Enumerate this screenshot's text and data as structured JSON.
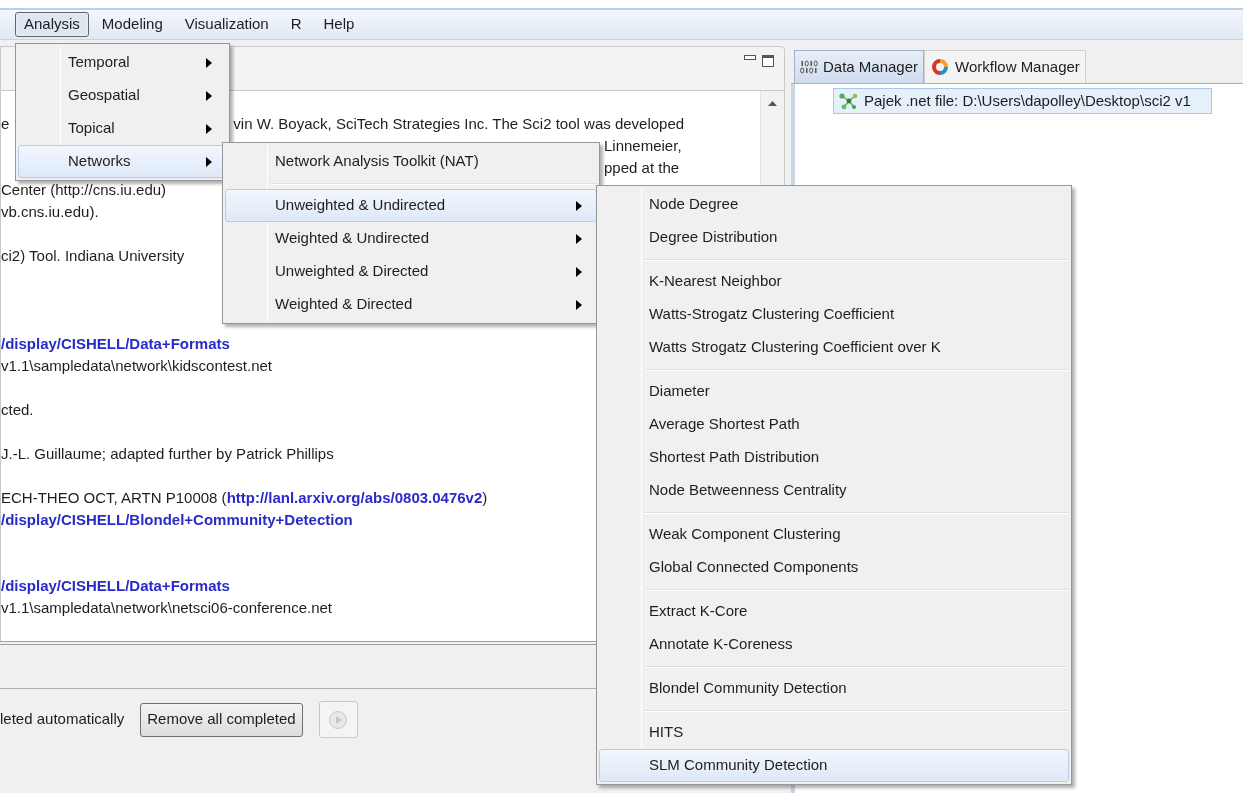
{
  "menu_bar": [
    {
      "label": "Analysis",
      "selected": true
    },
    {
      "label": "Modeling",
      "selected": false
    },
    {
      "label": "Visualization",
      "selected": false
    },
    {
      "label": "R",
      "selected": false
    },
    {
      "label": "Help",
      "selected": false
    }
  ],
  "menus": [
    {
      "items": [
        {
          "kind": "item",
          "label": "Temporal",
          "submenu": true,
          "selected": false
        },
        {
          "kind": "item",
          "label": "Geospatial",
          "submenu": true,
          "selected": false
        },
        {
          "kind": "item",
          "label": "Topical",
          "submenu": true,
          "selected": false
        },
        {
          "kind": "item",
          "label": "Networks",
          "submenu": true,
          "selected": true
        }
      ]
    },
    {
      "items": [
        {
          "kind": "item",
          "label": "Network Analysis Toolkit (NAT)",
          "submenu": false,
          "selected": false
        },
        {
          "kind": "separator"
        },
        {
          "kind": "item",
          "label": "Unweighted & Undirected",
          "submenu": true,
          "selected": true
        },
        {
          "kind": "item",
          "label": "Weighted & Undirected",
          "submenu": true,
          "selected": false
        },
        {
          "kind": "item",
          "label": "Unweighted & Directed",
          "submenu": true,
          "selected": false
        },
        {
          "kind": "item",
          "label": "Weighted & Directed",
          "submenu": true,
          "selected": false
        }
      ]
    },
    {
      "items": [
        {
          "kind": "item",
          "label": "Node Degree",
          "submenu": false,
          "selected": false
        },
        {
          "kind": "item",
          "label": "Degree Distribution",
          "submenu": false,
          "selected": false
        },
        {
          "kind": "separator"
        },
        {
          "kind": "item",
          "label": "K-Nearest Neighbor",
          "submenu": false,
          "selected": false
        },
        {
          "kind": "item",
          "label": "Watts-Strogatz Clustering Coefficient",
          "submenu": false,
          "selected": false
        },
        {
          "kind": "item",
          "label": "Watts Strogatz Clustering Coefficient over K",
          "submenu": false,
          "selected": false
        },
        {
          "kind": "separator"
        },
        {
          "kind": "item",
          "label": "Diameter",
          "submenu": false,
          "selected": false
        },
        {
          "kind": "item",
          "label": "Average Shortest Path",
          "submenu": false,
          "selected": false
        },
        {
          "kind": "item",
          "label": "Shortest Path Distribution",
          "submenu": false,
          "selected": false
        },
        {
          "kind": "item",
          "label": "Node Betweenness Centrality",
          "submenu": false,
          "selected": false
        },
        {
          "kind": "separator"
        },
        {
          "kind": "item",
          "label": "Weak Component Clustering",
          "submenu": false,
          "selected": false
        },
        {
          "kind": "item",
          "label": "Global Connected Components",
          "submenu": false,
          "selected": false
        },
        {
          "kind": "separator"
        },
        {
          "kind": "item",
          "label": "Extract K-Core",
          "submenu": false,
          "selected": false
        },
        {
          "kind": "item",
          "label": "Annotate K-Coreness",
          "submenu": false,
          "selected": false
        },
        {
          "kind": "separator"
        },
        {
          "kind": "item",
          "label": "Blondel Community Detection",
          "submenu": false,
          "selected": false
        },
        {
          "kind": "separator"
        },
        {
          "kind": "item",
          "label": "HITS",
          "submenu": false,
          "selected": false
        },
        {
          "kind": "item",
          "label": "SLM Community Detection",
          "submenu": false,
          "selected": true
        }
      ]
    }
  ],
  "console": {
    "paragraphs": [
      [
        {
          "segments": [
            {
              "kind": "text",
              "text": "e"
            },
            {
              "kind": "text",
              "text": "vin W. Boyack, SciTech Strategies Inc. The Sci2 tool was developed"
            }
          ]
        },
        {
          "segments": [
            {
              "kind": "text",
              "text": "Linnemeier,"
            }
          ]
        },
        {
          "segments": [
            {
              "kind": "text",
              "text": "pped at the"
            }
          ]
        },
        {
          "segments": [
            {
              "kind": "text",
              "text": "Center (http://cns.iu.edu)"
            }
          ]
        },
        {
          "segments": [
            {
              "kind": "text",
              "text": "vb.cns.iu.edu)."
            }
          ]
        }
      ],
      [
        {
          "segments": [
            {
              "kind": "text",
              "text": "ci2) Tool. Indiana University"
            }
          ]
        }
      ],
      [
        {
          "segments": [
            {
              "kind": "link",
              "text": "/display/CISHELL/Data+Formats"
            }
          ]
        },
        {
          "segments": [
            {
              "kind": "text",
              "text": "v1.1\\sampledata\\network\\kidscontest.net"
            }
          ]
        }
      ],
      [
        {
          "segments": [
            {
              "kind": "text",
              "text": "cted."
            }
          ]
        }
      ],
      [
        {
          "segments": [
            {
              "kind": "text",
              "text": "J.-L. Guillaume; adapted further by Patrick Phillips"
            }
          ]
        }
      ],
      [
        {
          "segments": [
            {
              "kind": "text",
              "text": "ECH-THEO OCT, ARTN P10008 ("
            },
            {
              "kind": "link",
              "text": "http://lanl.arxiv.org/abs/0803.0476v2"
            },
            {
              "kind": "text",
              "text": ")"
            }
          ]
        },
        {
          "segments": [
            {
              "kind": "link",
              "text": "/display/CISHELL/Blondel+Community+Detection"
            }
          ]
        }
      ],
      [
        {
          "segments": [
            {
              "kind": "link",
              "text": "/display/CISHELL/Data+Formats"
            }
          ]
        },
        {
          "segments": [
            {
              "kind": "text",
              "text": "v1.1\\sampledata\\network\\netsci06-conference.net"
            }
          ]
        }
      ]
    ]
  },
  "progress": {
    "status_text": "leted automatically",
    "button": "Remove all completed"
  },
  "data_panel": {
    "tabs": [
      {
        "label": "Data Manager",
        "selected": true
      },
      {
        "label": "Workflow Manager",
        "selected": false
      }
    ],
    "items": [
      {
        "label": "Pajek .net file: D:\\Users\\dapolley\\Desktop\\sci2 v1",
        "selected": true
      }
    ]
  }
}
